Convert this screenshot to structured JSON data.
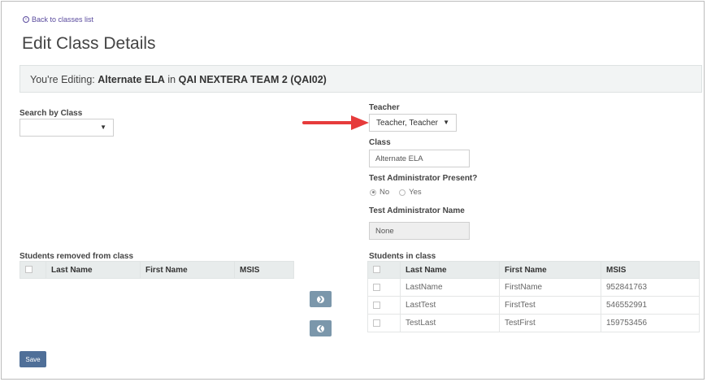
{
  "nav": {
    "back_label": "Back to classes list",
    "back_icon": "arrow-left-circle-icon"
  },
  "page": {
    "title": "Edit Class Details"
  },
  "banner": {
    "prefix": "You're Editing:",
    "class_name": "Alternate ELA",
    "connector": "in",
    "team_name": "QAI NEXTERA TEAM 2 (QAI02)"
  },
  "search": {
    "label": "Search by Class",
    "value": ""
  },
  "teacher": {
    "label": "Teacher",
    "value": "Teacher, Teacher"
  },
  "class_field": {
    "label": "Class",
    "value": "Alternate ELA"
  },
  "test_admin_present": {
    "label": "Test Administrator Present?",
    "options": [
      "No",
      "Yes"
    ],
    "selected": "No"
  },
  "test_admin_name": {
    "label": "Test Administrator Name",
    "value": "None"
  },
  "removed_table": {
    "title": "Students removed from class",
    "columns": [
      "Last Name",
      "First Name",
      "MSIS"
    ],
    "rows": []
  },
  "class_table": {
    "title": "Students in class",
    "columns": [
      "Last Name",
      "First Name",
      "MSIS"
    ],
    "rows": [
      [
        "LastName",
        "FirstName",
        "952841763"
      ],
      [
        "LastTest",
        "FirstTest",
        "546552991"
      ],
      [
        "TestLast",
        "TestFirst",
        "159753456"
      ]
    ]
  },
  "buttons": {
    "save": "Save",
    "move_right_icon": "arrow-right-icon",
    "move_left_icon": "arrow-left-icon"
  },
  "colors": {
    "accent": "#e63b3b",
    "button": "#4f6f98",
    "move_button": "#7b97ab",
    "link": "#5a4b9e"
  }
}
